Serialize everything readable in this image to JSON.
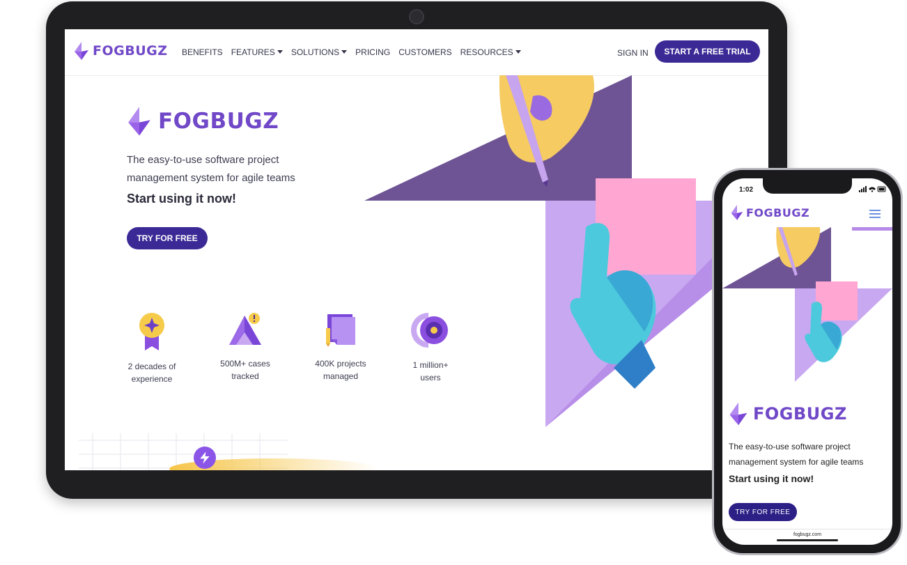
{
  "laptop": {
    "nav": {
      "logo_text": "FOGBUGZ",
      "items": [
        {
          "label": "BENEFITS",
          "dropdown": false
        },
        {
          "label": "FEATURES",
          "dropdown": true
        },
        {
          "label": "SOLUTIONS",
          "dropdown": true
        },
        {
          "label": "PRICING",
          "dropdown": false
        },
        {
          "label": "CUSTOMERS",
          "dropdown": false
        },
        {
          "label": "RESOURCES",
          "dropdown": true
        }
      ],
      "sign_in": "SIGN IN",
      "trial_button": "START A FREE TRIAL"
    },
    "hero": {
      "logo_text": "FOGBUGZ",
      "tagline": "The easy-to-use software project management system for agile teams",
      "cta_heading": "Start using it now!",
      "cta_button": "TRY FOR FREE"
    },
    "stats": [
      {
        "icon": "award-badge-icon",
        "line1": "2 decades of",
        "line2": "experience"
      },
      {
        "icon": "alert-triangle-icon",
        "line1": "500M+ cases",
        "line2": "tracked"
      },
      {
        "icon": "documents-icon",
        "line1": "400K projects",
        "line2": "managed"
      },
      {
        "icon": "target-icon",
        "line1": "1 million+",
        "line2": "users"
      }
    ]
  },
  "phone": {
    "time": "1:02",
    "status_icons": "signal-wifi-battery-icons",
    "logo_text": "FOGBUGZ",
    "hero_logo_text": "FOGBUGZ",
    "tagline": "The easy-to-use software project management system for agile teams",
    "cta_heading": "Start using it now!",
    "cta_button": "TRY FOR FREE",
    "url": "fogbugz.com"
  },
  "colors": {
    "brand_purple": "#7048c8",
    "button_indigo": "#3b2a96",
    "dark_triangle": "#6e5494",
    "light_triangle": "#c9a8f2",
    "sticky_note": "#ffa6d2",
    "hand_teal": "#4cc9dc",
    "hand_yellow": "#f6cb62"
  }
}
